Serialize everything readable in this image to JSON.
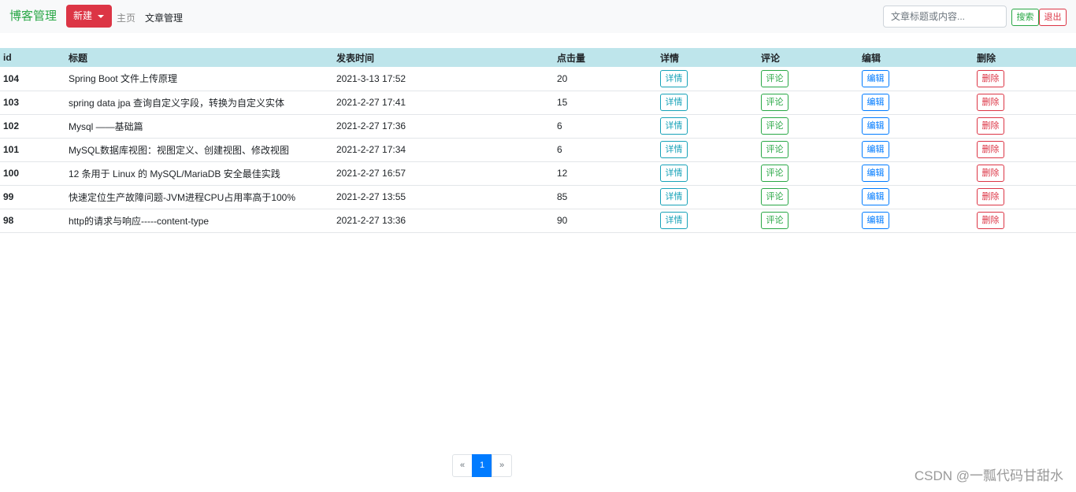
{
  "navbar": {
    "brand": "博客管理",
    "new_button": "新建",
    "home": "主页",
    "articles": "文章管理",
    "search_placeholder": "文章标题或内容...",
    "search_button": "搜索",
    "logout_button": "退出"
  },
  "table": {
    "headers": {
      "id": "id",
      "title": "标题",
      "date": "发表时间",
      "hits": "点击量",
      "detail": "详情",
      "comment": "评论",
      "edit": "编辑",
      "delete": "删除"
    },
    "buttons": {
      "detail": "详情",
      "comment": "评论",
      "edit": "编辑",
      "delete": "删除"
    },
    "rows": [
      {
        "id": "104",
        "title": "Spring Boot 文件上传原理",
        "date": "2021-3-13 17:52",
        "hits": "20"
      },
      {
        "id": "103",
        "title": "spring data jpa 查询自定义字段，转换为自定义实体",
        "date": "2021-2-27 17:41",
        "hits": "15"
      },
      {
        "id": "102",
        "title": "Mysql ——基础篇",
        "date": "2021-2-27 17:36",
        "hits": "6"
      },
      {
        "id": "101",
        "title": "MySQL数据库视图：视图定义、创建视图、修改视图",
        "date": "2021-2-27 17:34",
        "hits": "6"
      },
      {
        "id": "100",
        "title": "12 条用于 Linux 的 MySQL/MariaDB 安全最佳实践",
        "date": "2021-2-27 16:57",
        "hits": "12"
      },
      {
        "id": "99",
        "title": "快速定位生产故障问题-JVM进程CPU占用率高于100%",
        "date": "2021-2-27 13:55",
        "hits": "85"
      },
      {
        "id": "98",
        "title": "http的请求与响应-----content-type",
        "date": "2021-2-27 13:36",
        "hits": "90"
      }
    ]
  },
  "pagination": {
    "prev": "«",
    "current": "1",
    "next": "»"
  },
  "watermark": "CSDN @一瓢代码甘甜水",
  "colors": {
    "brand": "#28a745",
    "danger": "#dc3545",
    "info": "#17a2b8",
    "primary": "#007bff",
    "header_bg": "#bee5eb"
  }
}
